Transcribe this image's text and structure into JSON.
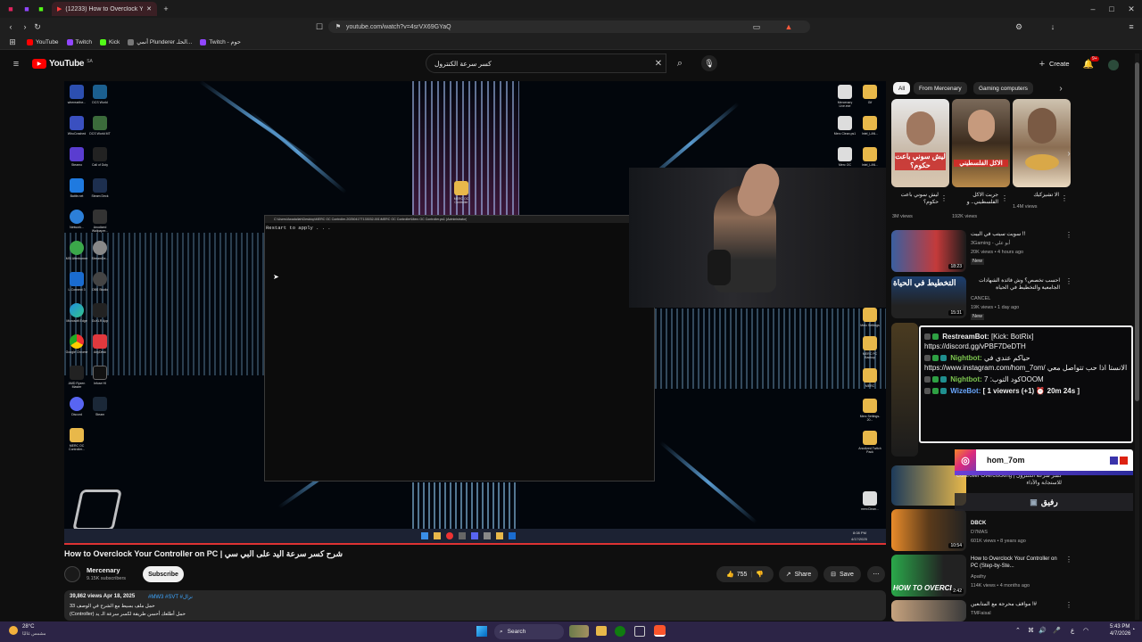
{
  "browser": {
    "tabs": [
      {
        "title": "(12233) How to Overclock Yo"
      }
    ],
    "url": "youtube.com/watch?v=4srVX69GYaQ",
    "bookmarks": [
      "YouTube",
      "Twitch",
      "Kick",
      "أنمي Plunderer الحلـ...",
      "Twitch - حوم"
    ]
  },
  "youtube": {
    "logo_text": "YouTube",
    "logo_region": "SA",
    "search_value": "كسر سرعة الكنترول",
    "create_label": "Create",
    "notif_count": "9+"
  },
  "video": {
    "cmd_title": "C:\\Users\\Awadallah\\Desktop\\MERC OC Controller-20250417T133032-001\\MERC OC Controller\\Merc OC Controller.ps1 (Administrator)",
    "cmd_text": "Restart to apply . . .",
    "desktop_icons_left": [
      "wherearthe...",
      "DCS World",
      "WhoCrashed",
      "DCS World MT",
      "Steamo",
      "Call of Duty",
      "Battle.net",
      "Steam Deck",
      "Network...",
      "Anodized Wallpaper...",
      "MSI Afterburner",
      "StreamDe...",
      "L-Connect 3",
      "OBS Studio",
      "Microsoft Edge",
      "GoXLR App",
      "Google Chrome",
      "AnyDesk",
      "AMD Ryzen Master",
      "Infuse HI",
      "Discord",
      "Steam",
      "MERC OC Controller..."
    ],
    "desktop_icons_right": [
      "Mercenary Live.exe",
      "Gif",
      "Merc Clean.ps1",
      "Intel_LAN...",
      "Merc OC",
      "Intel_LAN...",
      "Merc Settings",
      "MERC PC Backup",
      "MERC",
      "Merc Settings-20...",
      "Anodized Twitch Pack",
      "mercClean..."
    ],
    "center_folder": "MERC OC Controller",
    "clock": "8:08 PM",
    "date": "4/17/2025"
  },
  "info": {
    "title": "How to Overclock Your Controller on PC | شرح كسر سرعة اليد على البي سي",
    "channel": "Mercenary",
    "subs": "9.15K subscribers",
    "subscribe_label": "Subscribe",
    "likes": "755",
    "share_label": "Share",
    "save_label": "Save",
    "views_date": "39,862 views  Apr 18, 2025",
    "hashtags": "#MW3 #SVT #نزال",
    "desc_line1": "شرح كسر سرعة اليد على البي سي",
    "desc_line2": "33 حمل ملف بسيط مع الشرح في الوصف",
    "desc_line3": "(Controller) حمل أطلعك أحسن طريقة لكسر سرعة الـ يد"
  },
  "sidebar": {
    "chips": [
      "All",
      "From Mercenary",
      "Gaming computers"
    ],
    "shorts": [
      {
        "title": "ليش سوني باعت حكوم؟",
        "views": "3M views",
        "overlay": "ليش سوني باعت حكوم؟"
      },
      {
        "title": "جربت الاكل الفلسطيني.. و",
        "views": "192K views",
        "overlay": "الاكل الفلسطيني"
      },
      {
        "title": "الا تشيزكيك",
        "views": "1.4M views",
        "overlay": ""
      }
    ],
    "videos": [
      {
        "title": "سويت سيتب في البيت !!",
        "channel": "3Gaming - أبو علي",
        "meta": "20K views • 4 hours ago",
        "badge": "New",
        "duration": "18:23"
      },
      {
        "title": "احسب تخصص؟ وش فائدة الشهادات الجامعية والتخطيط في الحياة",
        "channel": "Dev Error",
        "meta2": "CANCEL",
        "meta": "19K views • 1 day ago",
        "badge": "New",
        "duration": "15:31",
        "overlay": "التخطيط في الحياة"
      },
      {
        "title": "Controller Overclocking | كسر سرعة الكنترول للاستجابة والأداء",
        "channel": "",
        "meta": "",
        "duration": ""
      },
      {
        "title": "DBCK",
        "channel": "D7MAS",
        "meta": "601K views • 8 years ago",
        "duration": "10:54"
      },
      {
        "title": "How to Overclock Your Controller on PC (Step-by-Ste...",
        "channel": "Apathy",
        "meta": "114K views • 4 months ago",
        "duration": "2:42",
        "overlay": "HOW TO OVERCL"
      },
      {
        "title": "مواقف محرجة مع المتابعين !#",
        "channel": "TMFaisal",
        "meta": "",
        "duration": ""
      }
    ]
  },
  "chat": {
    "lines": [
      {
        "user": "RestreamBot:",
        "msg": "[Kick: BotRix] https://discord.gg/vPBF7DeDTH"
      },
      {
        "user": "Nightbot:",
        "msg": "حياكم عندي في https://www.instagram.com/hom_7om/ الانستا اذا حب تتواصل معي"
      },
      {
        "user": "Nightbot:",
        "msg": "كود التوب: 7OOOM"
      },
      {
        "user": "WizeBot:",
        "msg": "[ 1 viewers (+1) ⏰ 20m 24s ]"
      }
    ],
    "instagram": "hom_7om",
    "rafeeq": "رفيق"
  },
  "taskbar": {
    "weather_temp": "28°C",
    "weather_desc": "مشمس غالبًا",
    "search_label": "Search",
    "time": "5:43 PM",
    "date": "4/7/2026",
    "lang": "ع"
  },
  "colors": {
    "yt_red": "#ff0000",
    "accent_purple": "#6a3fd8",
    "chat_green": "#7ec850"
  }
}
